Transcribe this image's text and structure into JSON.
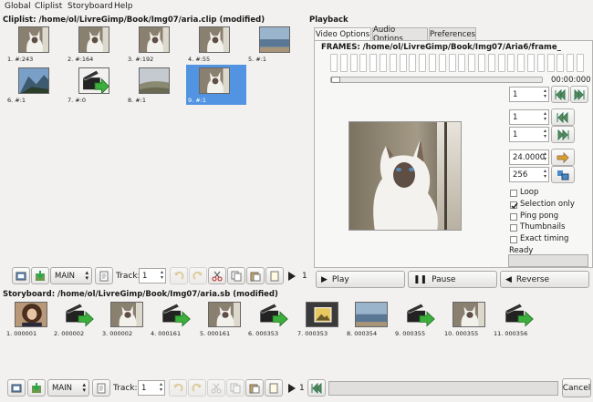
{
  "menu": [
    "Global",
    "Cliplist",
    "Storyboard",
    "Help"
  ],
  "cliplist": {
    "title": "Cliplist: /home/ol/LivreGimp/Book/Img07/aria.clip (modified)",
    "items": [
      {
        "label": "1. #:243",
        "kind": "cat"
      },
      {
        "label": "2. #:164",
        "kind": "cat"
      },
      {
        "label": "3. #:192",
        "kind": "cat"
      },
      {
        "label": "4. #:55",
        "kind": "cat"
      },
      {
        "label": "5. #:1",
        "kind": "sea"
      },
      {
        "label": "6. #:1",
        "kind": "mountain"
      },
      {
        "label": "7. #:0",
        "kind": "clapper"
      },
      {
        "label": "8. #:1",
        "kind": "hills"
      },
      {
        "label": "9. #:1",
        "kind": "cat"
      }
    ],
    "toolbar": {
      "combo": "MAIN",
      "track_label": "Track:",
      "track_value": "1"
    }
  },
  "storyboard": {
    "title": "Storyboard: /home/ol/LivreGimp/Book/Img07/aria.sb (modified)",
    "items": [
      {
        "label": "1. 000001",
        "kind": "person"
      },
      {
        "label": "2. 000002",
        "kind": "clapper"
      },
      {
        "label": "3. 000002",
        "kind": "cat"
      },
      {
        "label": "4. 000161",
        "kind": "clapper"
      },
      {
        "label": "5. 000161",
        "kind": "cat"
      },
      {
        "label": "6. 000353",
        "kind": "clapper"
      },
      {
        "label": "7. 000353",
        "kind": "frame"
      },
      {
        "label": "8. 000354",
        "kind": "sea"
      },
      {
        "label": "9. 000355",
        "kind": "clapper"
      },
      {
        "label": "10. 000355",
        "kind": "cat"
      },
      {
        "label": "11. 000356",
        "kind": "clapper"
      }
    ],
    "toolbar": {
      "combo": "MAIN",
      "track_label": "Track:",
      "track_value": "1",
      "counter": "1",
      "cancel": "Cancel"
    }
  },
  "playback": {
    "title": "Playback",
    "tabs": [
      "Video Options",
      "Audio Options",
      "Preferences"
    ],
    "frames_label": "FRAMES: /home/ol/LivreGimp/Book/Img07/Aria6/frame_",
    "time": "00:00:000",
    "spin1": "1",
    "spin2": "1",
    "spin3": "1",
    "speed": "24.0000",
    "size": "256",
    "options": [
      {
        "label": "Loop",
        "checked": false
      },
      {
        "label": "Selection only",
        "checked": true
      },
      {
        "label": "Ping pong",
        "checked": false
      },
      {
        "label": "Thumbnails",
        "checked": false
      },
      {
        "label": "Exact timing",
        "checked": false
      }
    ],
    "status": "Ready",
    "play": "Play",
    "pause": "Pause",
    "reverse": "Reverse"
  }
}
